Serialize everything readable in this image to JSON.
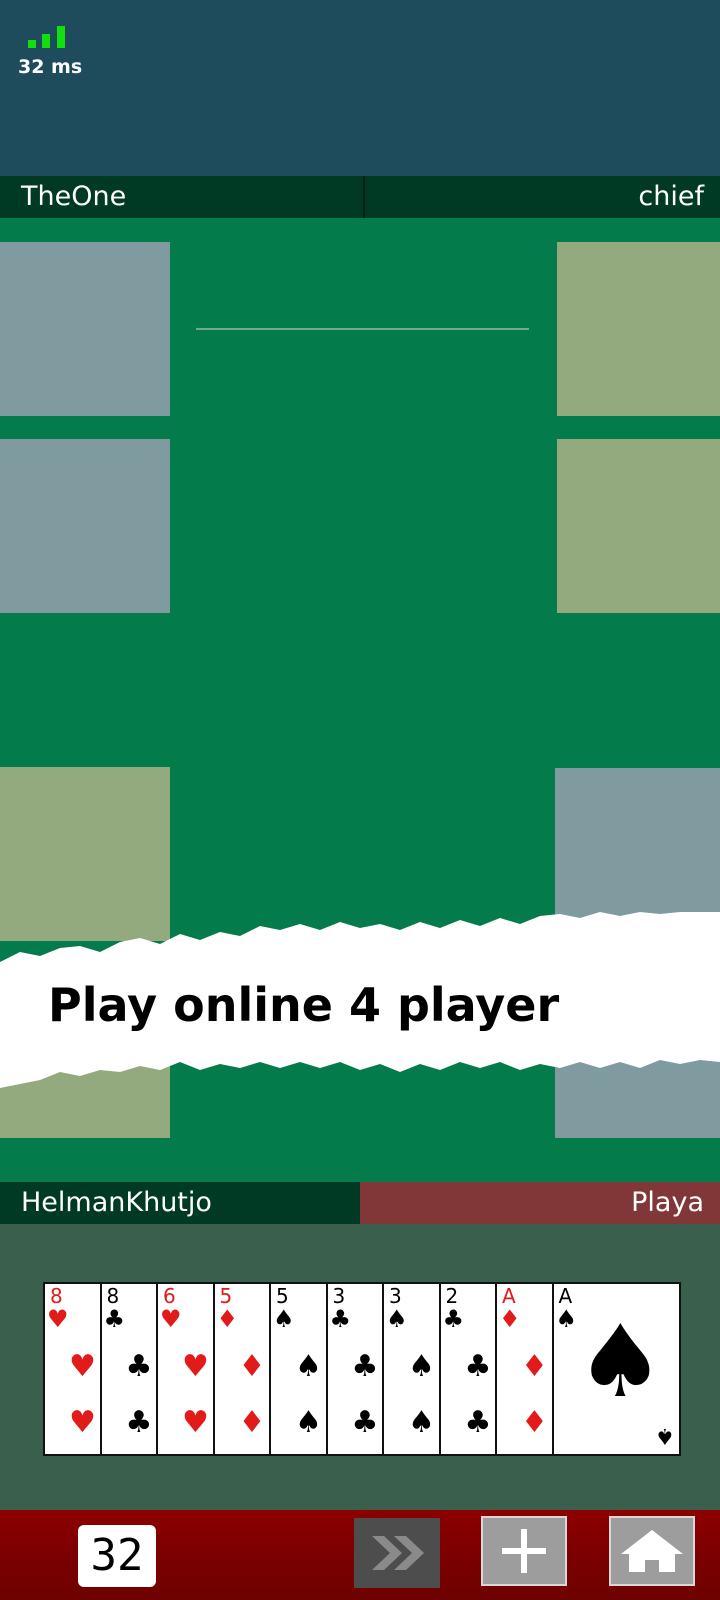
{
  "status": {
    "ping": "32 ms",
    "signal_color": "#12e00c"
  },
  "players": {
    "top_left": "TheOne",
    "top_right": "chief",
    "bottom_left": "HelmanKhutjo",
    "bottom_right": "Playa"
  },
  "colors": {
    "active_player": "#813737",
    "table": "#047b4a",
    "bottom_bar": "#7a0000"
  },
  "banner": {
    "text": "Play online 4 player"
  },
  "hand": [
    {
      "rank": "8",
      "suit": "hearts"
    },
    {
      "rank": "8",
      "suit": "clubs"
    },
    {
      "rank": "6",
      "suit": "hearts"
    },
    {
      "rank": "5",
      "suit": "diamonds"
    },
    {
      "rank": "5",
      "suit": "spades"
    },
    {
      "rank": "3",
      "suit": "clubs"
    },
    {
      "rank": "3",
      "suit": "spades"
    },
    {
      "rank": "2",
      "suit": "clubs"
    },
    {
      "rank": "A",
      "suit": "diamonds"
    },
    {
      "rank": "A",
      "suit": "spades"
    }
  ],
  "controls": {
    "counter": "32",
    "skip_icon": "double-chevron-right-icon",
    "add_icon": "plus-icon",
    "home_icon": "home-icon"
  }
}
